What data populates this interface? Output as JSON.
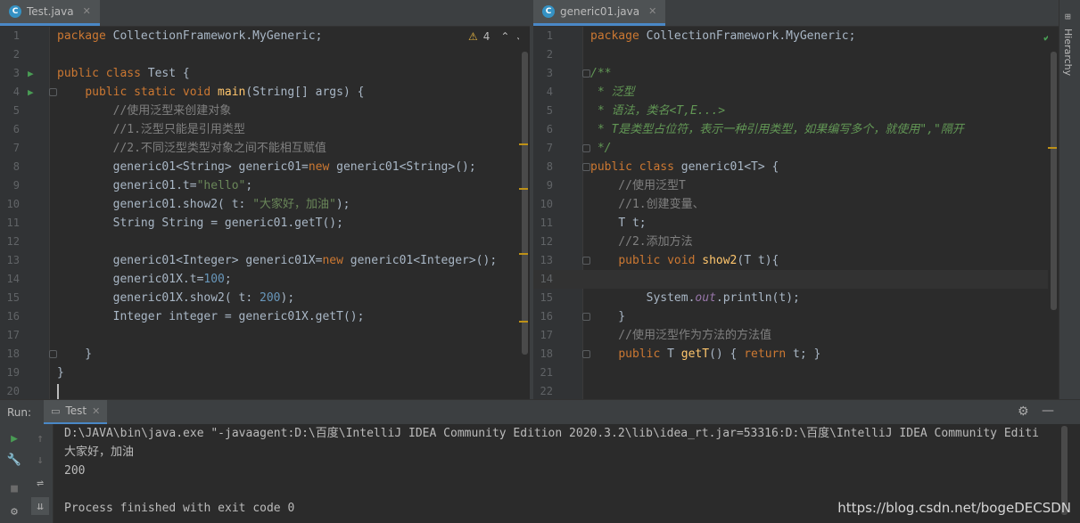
{
  "left_tab": {
    "label": "Test.java",
    "icon": "java-class-icon"
  },
  "right_tab": {
    "label": "generic01.java",
    "icon": "java-class-icon"
  },
  "warnings": {
    "count": "4"
  },
  "right_panel": {
    "label": "Hierarchy"
  },
  "left_editor": {
    "lines": [
      {
        "n": "1",
        "code": "package CollectionFramework.MyGeneric;"
      },
      {
        "n": "2",
        "code": ""
      },
      {
        "n": "3",
        "code": "public class Test {"
      },
      {
        "n": "4",
        "code": "    public static void main(String[] args) {"
      },
      {
        "n": "5",
        "code": "        //使用泛型来创建对象"
      },
      {
        "n": "6",
        "code": "        //1.泛型只能是引用类型"
      },
      {
        "n": "7",
        "code": "        //2.不同泛型类型对象之间不能相互赋值"
      },
      {
        "n": "8",
        "code": "        generic01<String> generic01=new generic01<String>();"
      },
      {
        "n": "9",
        "code": "        generic01.t=\"hello\";"
      },
      {
        "n": "10",
        "code": "        generic01.show2( t: \"大家好，加油\");"
      },
      {
        "n": "11",
        "code": "        String String = generic01.getT();"
      },
      {
        "n": "12",
        "code": ""
      },
      {
        "n": "13",
        "code": "        generic01<Integer> generic01X=new generic01<Integer>();"
      },
      {
        "n": "14",
        "code": "        generic01X.t=100;"
      },
      {
        "n": "15",
        "code": "        generic01X.show2( t: 200);"
      },
      {
        "n": "16",
        "code": "        Integer integer = generic01X.getT();"
      },
      {
        "n": "17",
        "code": ""
      },
      {
        "n": "18",
        "code": "    }"
      },
      {
        "n": "19",
        "code": "}"
      },
      {
        "n": "20",
        "code": ""
      }
    ]
  },
  "right_editor": {
    "lines": [
      {
        "n": "1",
        "code": "package CollectionFramework.MyGeneric;"
      },
      {
        "n": "2",
        "code": ""
      },
      {
        "n": "3",
        "code": "/**"
      },
      {
        "n": "4",
        "code": " * 泛型"
      },
      {
        "n": "5",
        "code": " * 语法，类名<T,E...>"
      },
      {
        "n": "6",
        "code": " * T是类型占位符，表示一种引用类型，如果编写多个，就使用\",\"隔开"
      },
      {
        "n": "7",
        "code": " */"
      },
      {
        "n": "8",
        "code": "public class generic01<T> {"
      },
      {
        "n": "9",
        "code": "    //使用泛型T"
      },
      {
        "n": "10",
        "code": "    //1.创建变量、"
      },
      {
        "n": "11",
        "code": "    T t;"
      },
      {
        "n": "12",
        "code": "    //2.添加方法"
      },
      {
        "n": "13",
        "code": "    public void show2(T t){"
      },
      {
        "n": "14",
        "code": ""
      },
      {
        "n": "15",
        "code": "        System.out.println(t);"
      },
      {
        "n": "16",
        "code": "    }"
      },
      {
        "n": "17",
        "code": "    //使用泛型作为方法的方法值"
      },
      {
        "n": "18",
        "code": "    public T getT() { return t; }"
      },
      {
        "n": "21",
        "code": ""
      },
      {
        "n": "22",
        "code": ""
      }
    ]
  },
  "run_panel": {
    "label": "Run:",
    "config": "Test",
    "output": [
      "D:\\JAVA\\bin\\java.exe \"-javaagent:D:\\百度\\IntelliJ IDEA Community Edition 2020.3.2\\lib\\idea_rt.jar=53316:D:\\百度\\IntelliJ IDEA Community Editi",
      "大家好，加油",
      "200",
      "",
      "Process finished with exit code 0"
    ]
  },
  "watermark": "https://blog.csdn.net/bogeDECSDN",
  "colors": {
    "keyword": "#cc7832",
    "string": "#6a8759",
    "number": "#6897bb",
    "function": "#ffc66d",
    "accent": "#4a88c7"
  }
}
